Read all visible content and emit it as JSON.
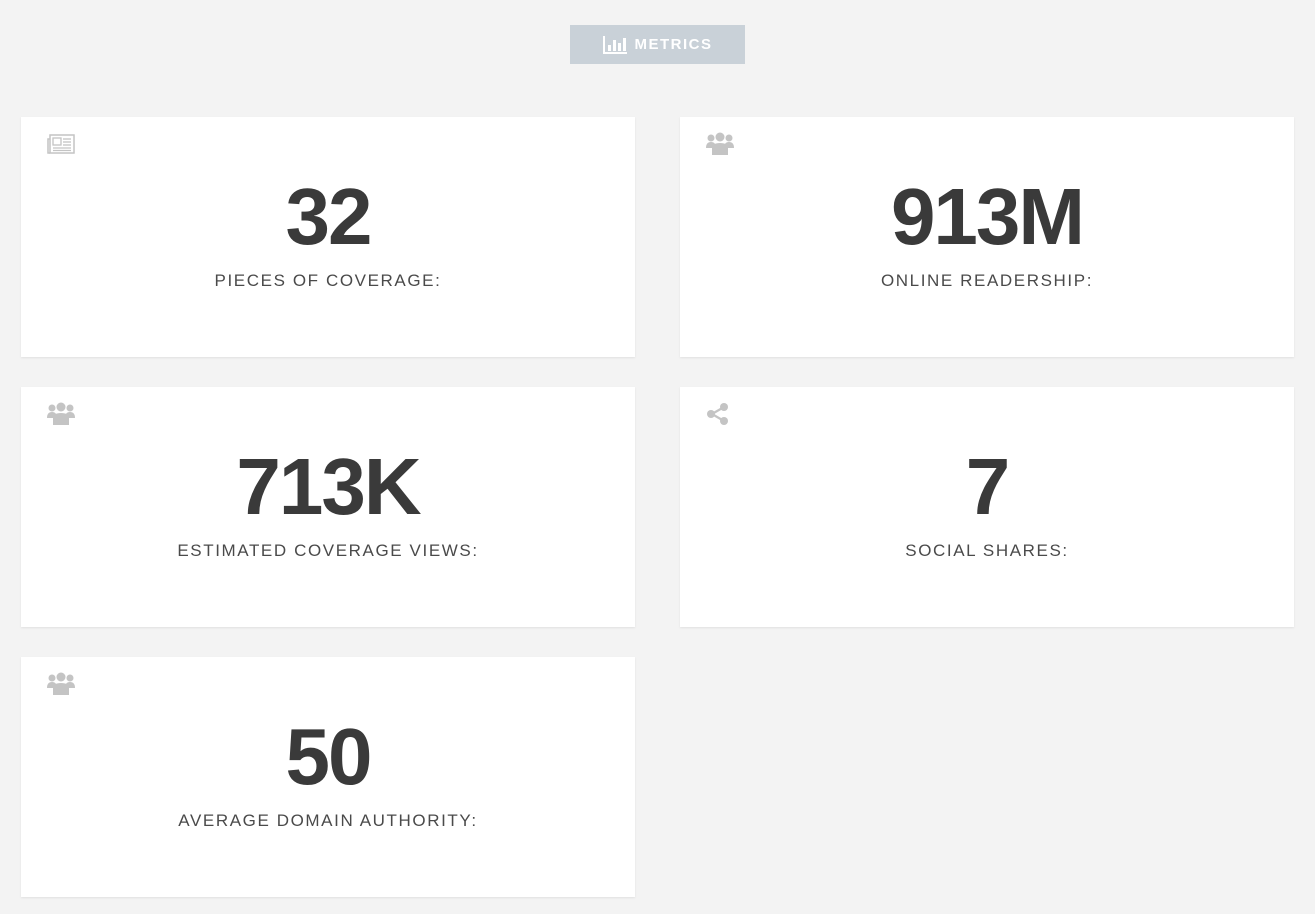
{
  "header": {
    "label": "METRICS",
    "icon": "bar-chart-icon",
    "background": "#c9d1d8"
  },
  "metrics": [
    {
      "value": "32",
      "label": "PIECES OF COVERAGE:",
      "icon": "newspaper-icon"
    },
    {
      "value": "913M",
      "label": "ONLINE READERSHIP:",
      "icon": "users-icon"
    },
    {
      "value": "713K",
      "label": "ESTIMATED COVERAGE VIEWS:",
      "icon": "users-icon"
    },
    {
      "value": "7",
      "label": "SOCIAL SHARES:",
      "icon": "share-icon"
    },
    {
      "value": "50",
      "label": "AVERAGE DOMAIN AUTHORITY:",
      "icon": "users-icon"
    }
  ],
  "colors": {
    "page_background": "#f3f3f3",
    "card_background": "#ffffff",
    "value_text": "#3a3a3a",
    "icon": "#c4c4c4"
  }
}
